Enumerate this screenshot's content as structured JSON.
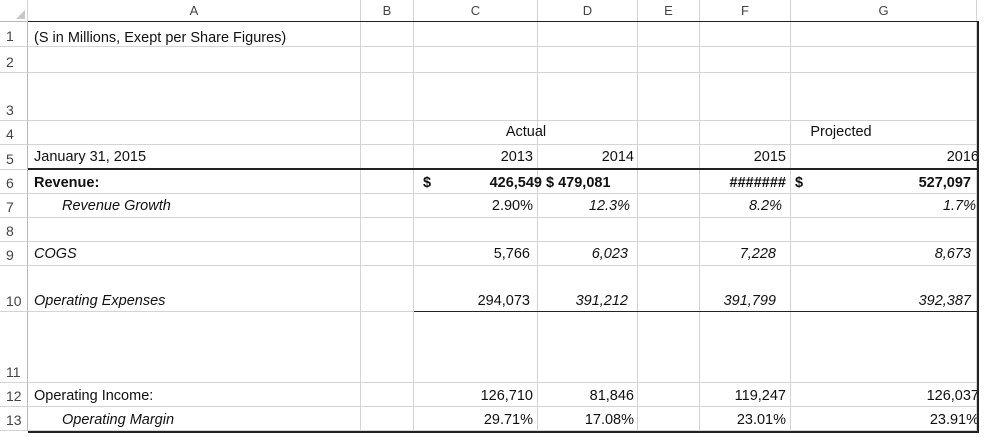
{
  "columns": [
    "A",
    "B",
    "C",
    "D",
    "E",
    "F",
    "G"
  ],
  "rows": [
    "1",
    "2",
    "3",
    "4",
    "5",
    "6",
    "7",
    "8",
    "9",
    "10",
    "11",
    "12",
    "13"
  ],
  "cells": {
    "A1": "(S in Millions, Exept per Share Figures)",
    "C4": "Actual",
    "G4": "Projected",
    "A5": "January 31, 2015",
    "C5": "2013",
    "D5": "2014",
    "F5": "2015",
    "G5": "2016",
    "A6": "Revenue:",
    "B6": "$",
    "C6": "426,549",
    "D6": "$ 479,081",
    "F6": "#######",
    "F6b": "$",
    "G6": "527,097",
    "A7": "Revenue Growth",
    "C7": "2.90%",
    "D7": "12.3%",
    "F7": "8.2%",
    "G7": "1.7%",
    "A9": "COGS",
    "C9": "5,766",
    "D9": "6,023",
    "F9": "7,228",
    "G9": "8,673",
    "A10": "Operating Expenses",
    "C10": "294,073",
    "D10": "391,212",
    "F10": "391,799",
    "G10": "392,387",
    "A12": "Operating Income:",
    "C12": "126,710",
    "D12": "81,846",
    "F12": "119,247",
    "G12": "126,037",
    "A13": "Operating Margin",
    "C13": "29.71%",
    "D13": "17.08%",
    "F13": "23.01%",
    "G13": "23.91%"
  }
}
